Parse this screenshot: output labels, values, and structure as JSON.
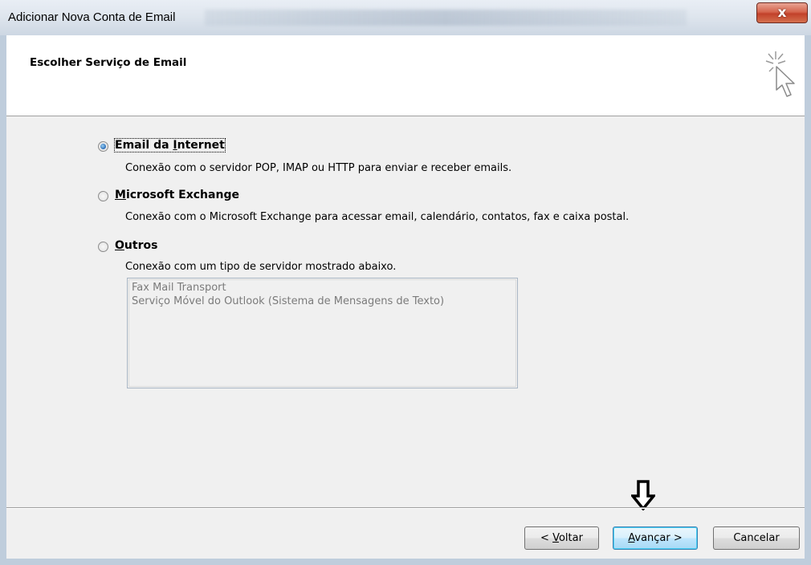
{
  "window": {
    "title": "Adicionar Nova Conta de Email",
    "close_glyph": "x"
  },
  "header": {
    "title": "Escolher Serviço de Email",
    "icon": "cursor-sparkle-icon"
  },
  "options": [
    {
      "label": "Email da Internet",
      "mnemonic": "I",
      "description": "Conexão com o servidor POP, IMAP ou HTTP para enviar e receber emails.",
      "selected": true
    },
    {
      "label": "Microsoft Exchange",
      "mnemonic": "M",
      "description": "Conexão com o Microsoft Exchange para acessar email, calendário, contatos, fax e caixa postal.",
      "selected": false
    },
    {
      "label": "Outros",
      "mnemonic": "O",
      "description": "Conexão com um tipo de servidor mostrado abaixo.",
      "selected": false
    }
  ],
  "other_services": [
    "Fax Mail Transport",
    "Serviço Móvel do Outlook (Sistema de Mensagens de Texto)"
  ],
  "buttons": {
    "back": {
      "prefix": "< ",
      "mnemonic": "V",
      "rest": "oltar"
    },
    "next": {
      "mnemonic": "A",
      "rest": "vançar >"
    },
    "cancel": "Cancelar"
  },
  "annotation": {
    "icon": "down-arrow-icon"
  }
}
